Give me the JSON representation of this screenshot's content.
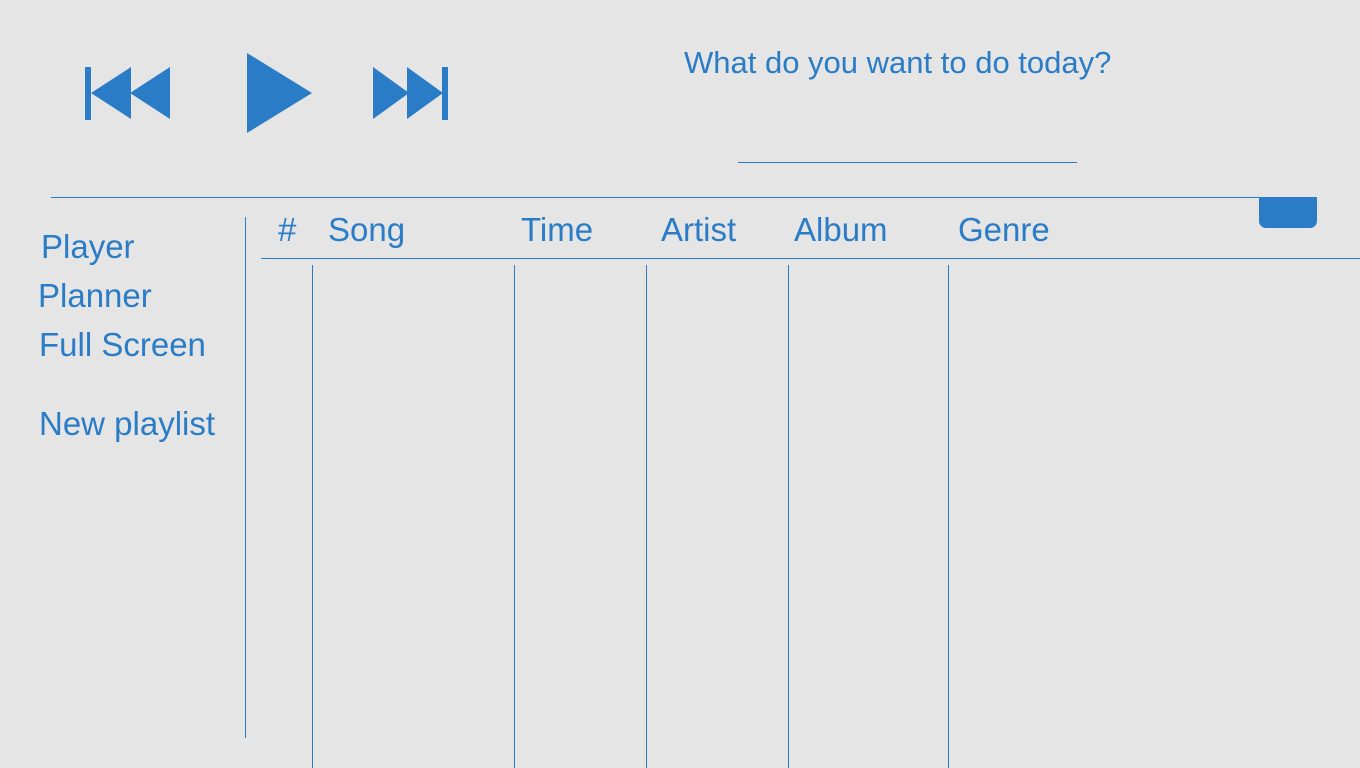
{
  "player": {
    "previous_icon": "skip-previous-icon",
    "play_icon": "play-icon",
    "next_icon": "skip-next-icon"
  },
  "search": {
    "prompt": "What do you want to do today?",
    "value": ""
  },
  "sidebar": {
    "items": [
      {
        "label": "Player"
      },
      {
        "label": "Planner"
      },
      {
        "label": "Full Screen"
      },
      {
        "label": "New playlist"
      }
    ]
  },
  "table": {
    "columns": [
      "#",
      "Song",
      "Time",
      "Artist",
      "Album",
      "Genre"
    ],
    "rows": []
  },
  "colors": {
    "accent": "#2a7cc7",
    "background": "#e5e5e5"
  }
}
